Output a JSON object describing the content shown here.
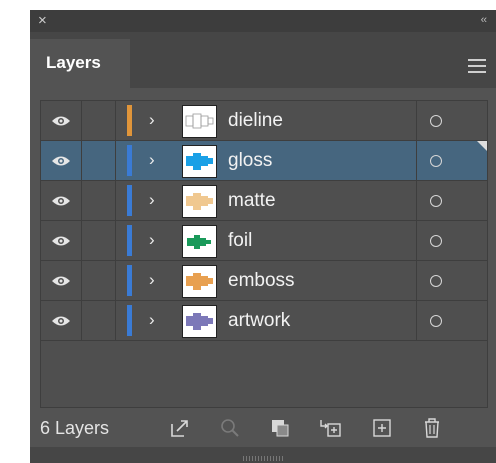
{
  "panel": {
    "close_glyph": "×",
    "collapse_glyph": "‹‹",
    "tab_label": "Layers"
  },
  "layers": [
    {
      "name": "dieline",
      "color": "#e0953a",
      "thumb": "dieline-thumb",
      "selected": false
    },
    {
      "name": "gloss",
      "color": "#3a7bd5",
      "thumb": "gloss-thumb",
      "selected": true
    },
    {
      "name": "matte",
      "color": "#3a7bd5",
      "thumb": "matte-thumb",
      "selected": false
    },
    {
      "name": "foil",
      "color": "#3a7bd5",
      "thumb": "foil-thumb",
      "selected": false
    },
    {
      "name": "emboss",
      "color": "#3a7bd5",
      "thumb": "emboss-thumb",
      "selected": false
    },
    {
      "name": "artwork",
      "color": "#3a7bd5",
      "thumb": "artwork-thumb",
      "selected": false
    }
  ],
  "footer": {
    "count_label": "6 Layers",
    "buttons": [
      "export-icon",
      "locate-object-icon",
      "make-clipping-mask-icon",
      "create-sublayer-icon",
      "create-new-layer-icon",
      "delete-layer-icon"
    ]
  },
  "colors": {
    "panel_bg": "#535353",
    "selected_row": "#46667f",
    "gloss_fill": "#1aa0e6",
    "matte_fill": "#f0c890",
    "foil_fill": "#1a9a5a",
    "emboss_fill": "#e8a050",
    "artwork_fill": "#7c78b8"
  }
}
